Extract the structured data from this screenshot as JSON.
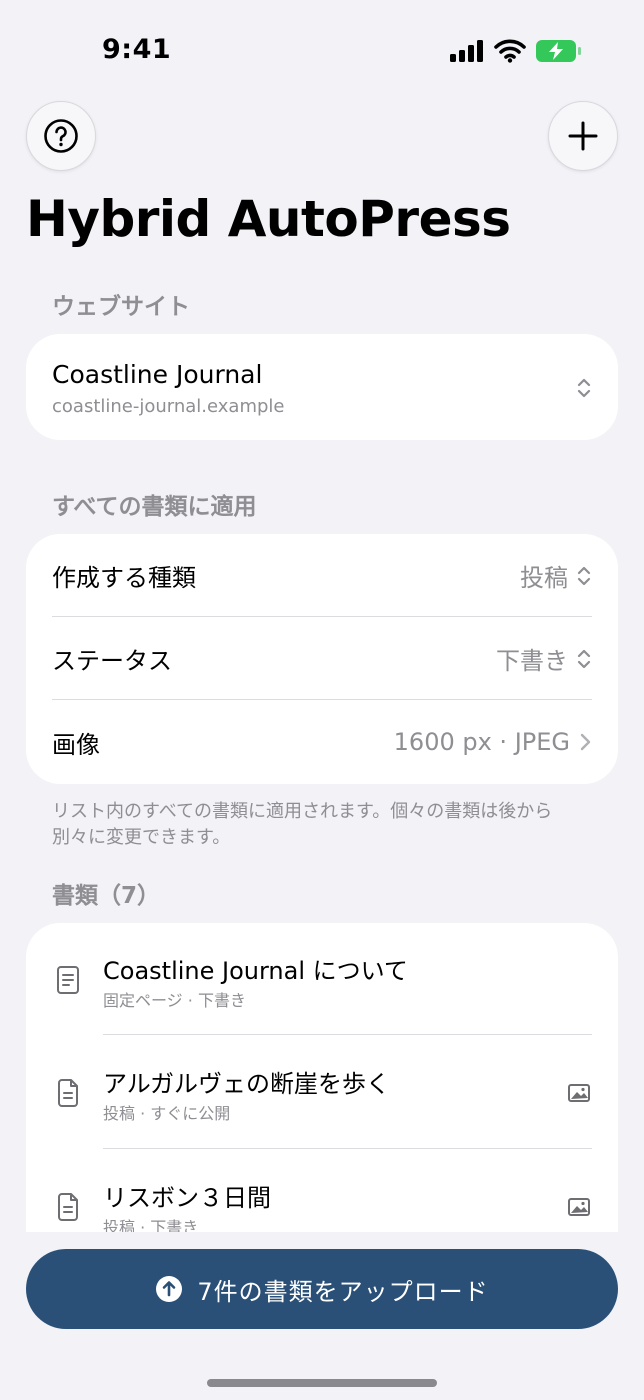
{
  "status_bar": {
    "time": "9:41"
  },
  "header": {
    "title": "Hybrid AutoPress"
  },
  "website_section": {
    "label": "ウェブサイト",
    "site_name": "Coastline Journal",
    "site_url": "coastline-journal.example"
  },
  "apply_section": {
    "label": "すべての書類に適用",
    "rows": [
      {
        "label": "作成する種類",
        "value": "投稿"
      },
      {
        "label": "ステータス",
        "value": "下書き"
      },
      {
        "label": "画像",
        "value": "1600 px · JPEG"
      }
    ],
    "note": "リスト内のすべての書類に適用されます。個々の書類は後から別々に変更できます。"
  },
  "documents_section": {
    "label": "書類（7）",
    "items": [
      {
        "title": "Coastline Journal について",
        "subtitle": "固定ページ · 下書き"
      },
      {
        "title": "アルガルヴェの断崖を歩く",
        "subtitle": "投稿 · すぐに公開"
      },
      {
        "title": "リスボン３日間",
        "subtitle": "投稿 · 下書き"
      }
    ]
  },
  "upload_button": {
    "label": "7件の書類をアップロード"
  },
  "colors": {
    "accent": "#2a5078",
    "background": "#f2f2f7",
    "secondary_text": "#8e8e93",
    "battery": "#34c759"
  }
}
